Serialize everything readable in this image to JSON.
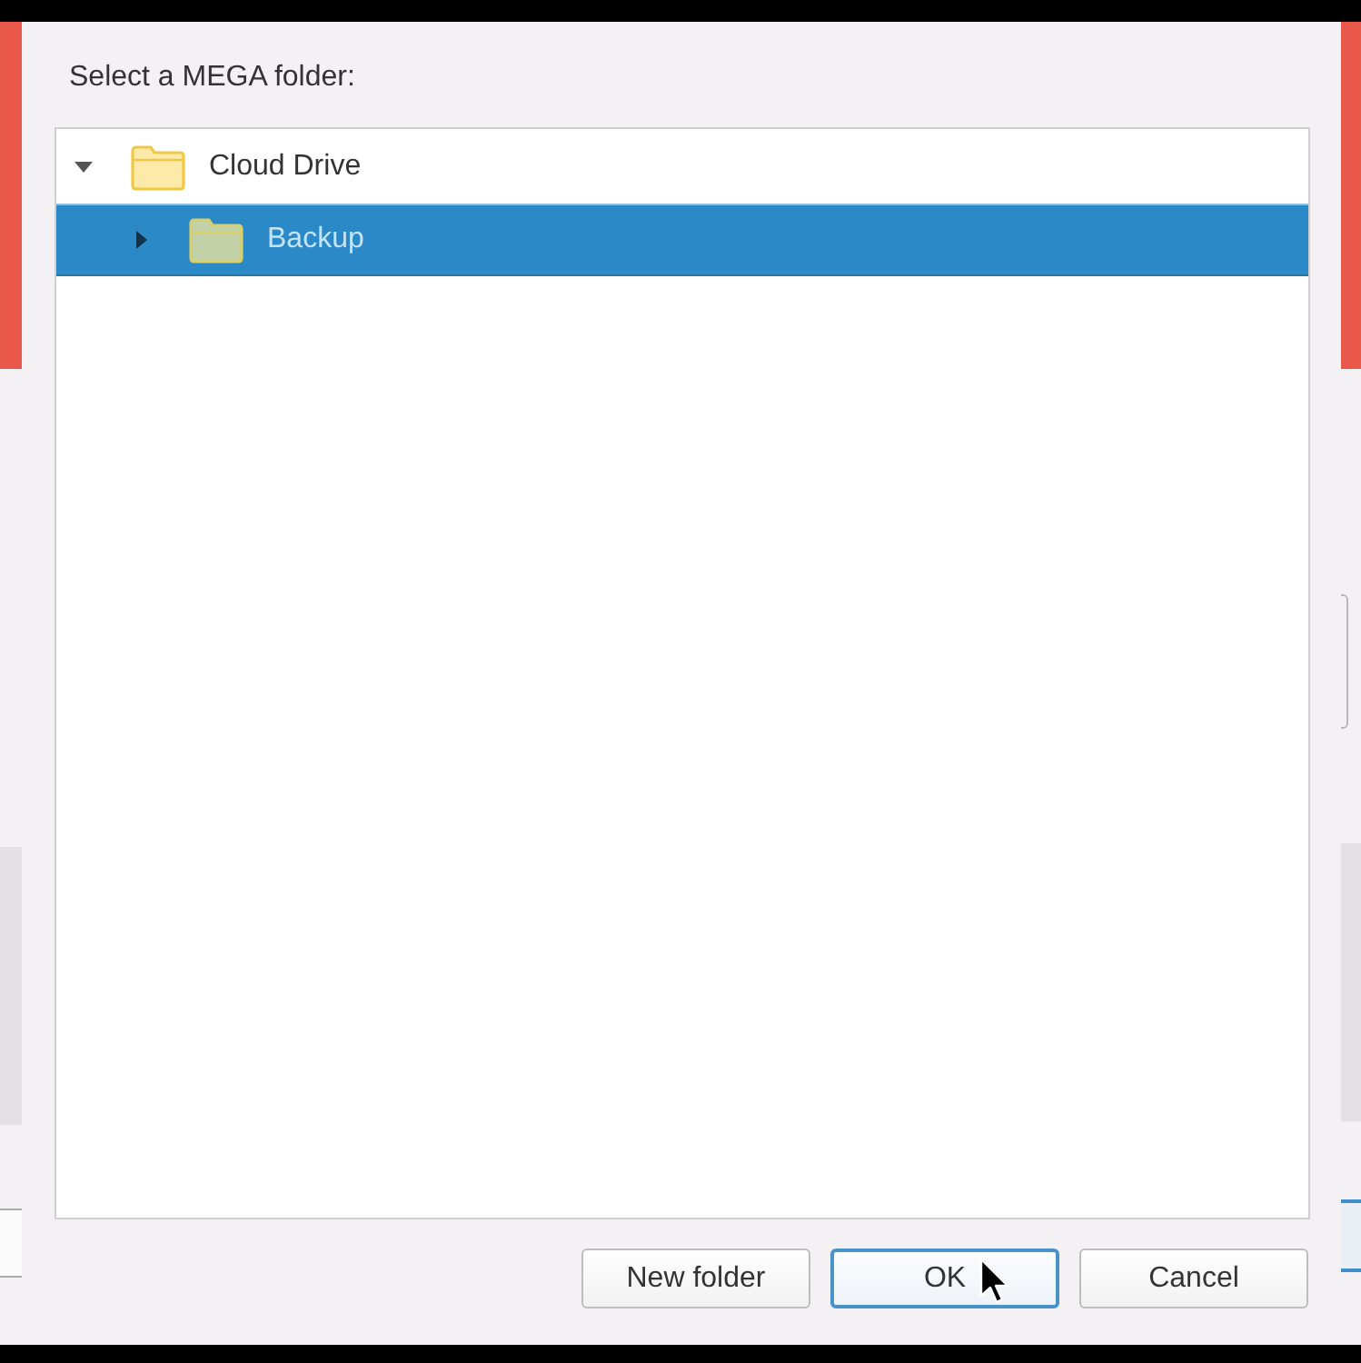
{
  "dialog": {
    "title": "Select a MEGA folder:",
    "tree": [
      {
        "label": "Cloud Drive",
        "expanded": true,
        "selected": false,
        "children": [
          {
            "label": "Backup",
            "expanded": false,
            "selected": true
          }
        ]
      }
    ],
    "buttons": [
      {
        "label": "New folder",
        "default": false
      },
      {
        "label": "OK",
        "default": true
      },
      {
        "label": "Cancel",
        "default": false
      }
    ]
  }
}
